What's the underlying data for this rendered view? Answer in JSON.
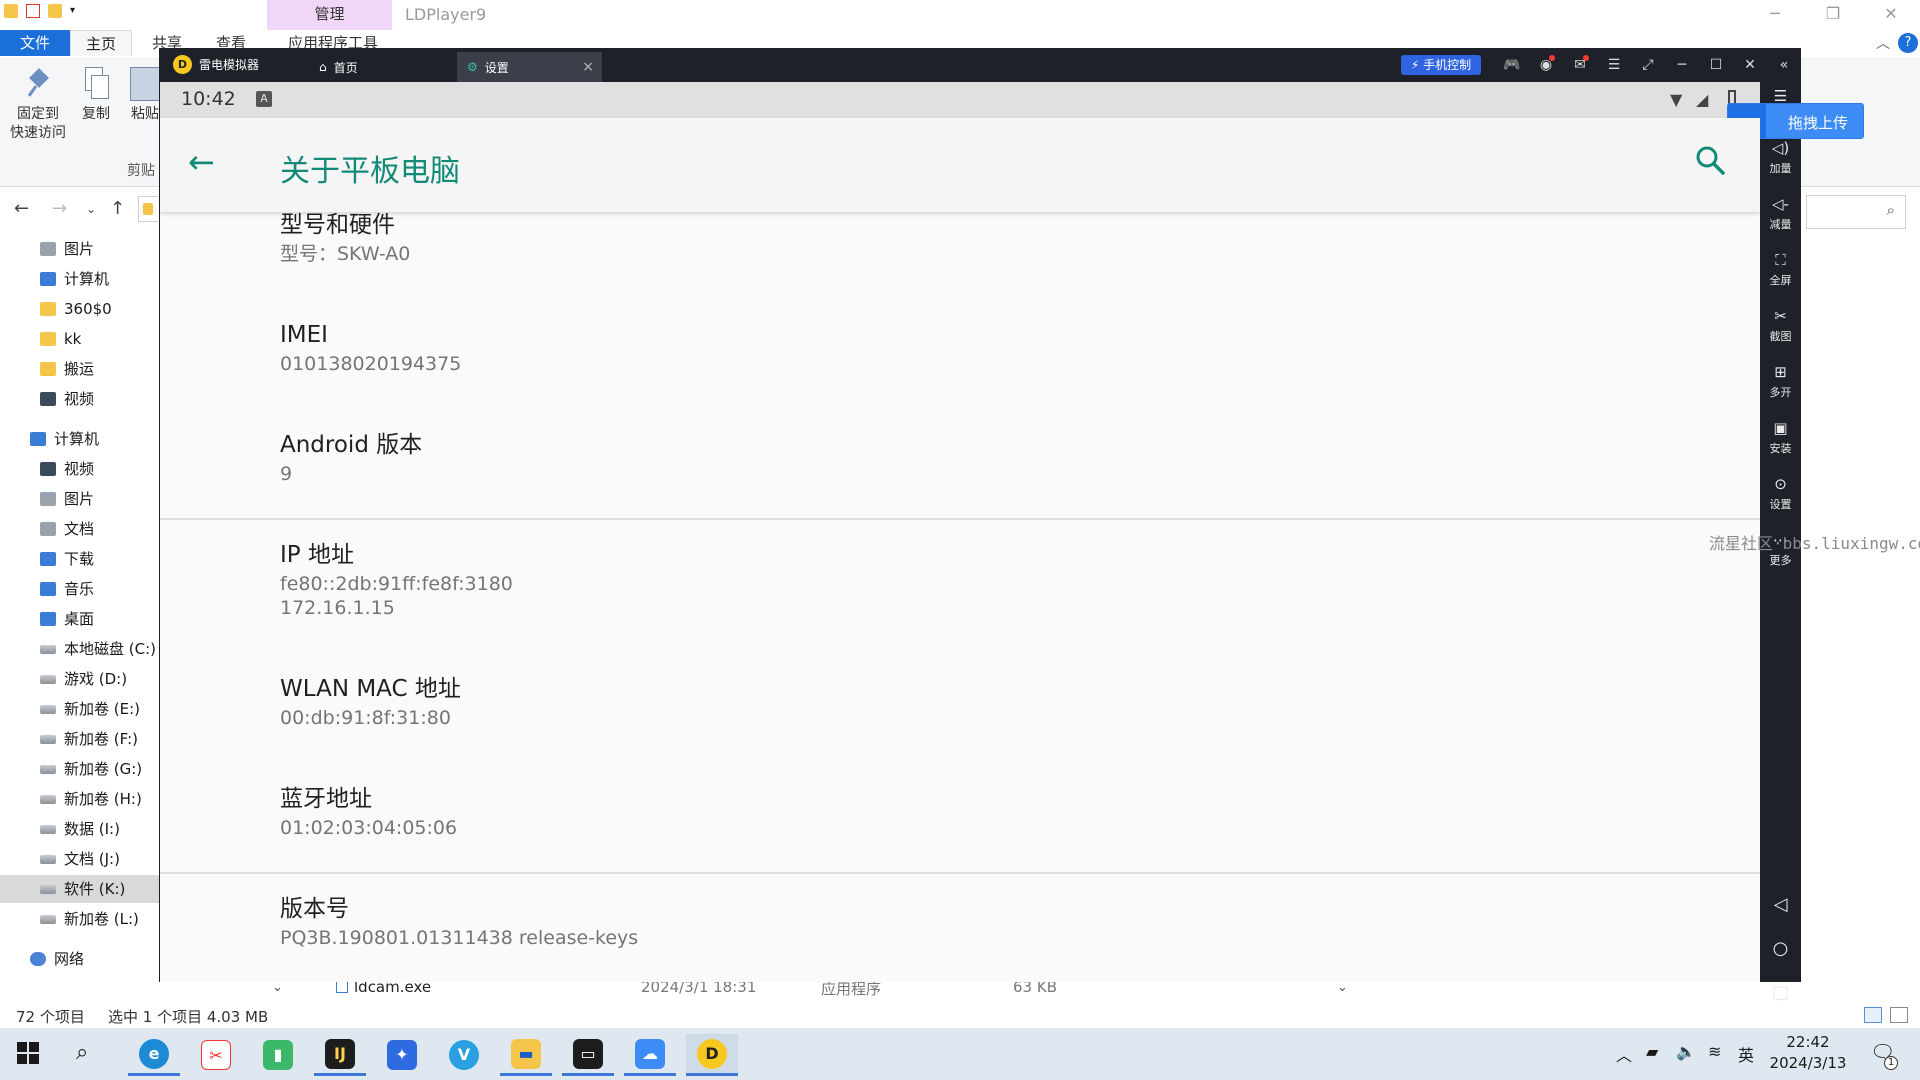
{
  "explorer": {
    "window_title": "LDPlayer9",
    "context_tab": "管理",
    "context_tab_sub": "应用程序工具",
    "ribbon_tabs": [
      "文件",
      "主页",
      "共享",
      "查看"
    ],
    "ribbon_buttons": [
      "固定到\n快速访问",
      "复制",
      "粘贴"
    ],
    "pin_label_1": "固定到",
    "pin_label_2": "快速访问",
    "copy_label": "复制",
    "paste_label": "粘贴",
    "clipboard_group": "剪贴",
    "nav_items": [
      {
        "label": "图片",
        "icon": "pictures-icon"
      },
      {
        "label": "计算机",
        "icon": "computer-icon"
      },
      {
        "label": "360$0",
        "icon": "folder-icon"
      },
      {
        "label": "kk",
        "icon": "folder-icon"
      },
      {
        "label": "搬运",
        "icon": "folder-icon"
      },
      {
        "label": "视频",
        "icon": "videos-icon"
      },
      {
        "label": "计算机",
        "icon": "computer-icon"
      },
      {
        "label": "视频",
        "icon": "videos-icon"
      },
      {
        "label": "图片",
        "icon": "pictures-icon"
      },
      {
        "label": "文档",
        "icon": "documents-icon"
      },
      {
        "label": "下载",
        "icon": "download-icon"
      },
      {
        "label": "音乐",
        "icon": "music-icon"
      },
      {
        "label": "桌面",
        "icon": "desktop-icon"
      },
      {
        "label": "本地磁盘 (C:)",
        "icon": "drive-icon"
      },
      {
        "label": "游戏 (D:)",
        "icon": "drive-icon"
      },
      {
        "label": "新加卷 (E:)",
        "icon": "drive-icon"
      },
      {
        "label": "新加卷 (F:)",
        "icon": "drive-icon"
      },
      {
        "label": "新加卷 (G:)",
        "icon": "drive-icon"
      },
      {
        "label": "新加卷 (H:)",
        "icon": "drive-icon"
      },
      {
        "label": "数据 (I:)",
        "icon": "drive-icon"
      },
      {
        "label": "文档 (J:)",
        "icon": "drive-icon"
      },
      {
        "label": "软件 (K:)",
        "icon": "drive-icon"
      },
      {
        "label": "新加卷 (L:)",
        "icon": "drive-icon"
      },
      {
        "label": "网络",
        "icon": "network-icon"
      }
    ],
    "file_peek": {
      "name": "ldcam.exe",
      "date": "2024/3/1 18:31",
      "type": "应用程序",
      "size": "63 KB"
    },
    "status_count": "72 个项目",
    "status_selected": "选中 1 个项目 4.03 MB"
  },
  "emulator": {
    "app_name": "雷电模拟器",
    "tabs": [
      {
        "label": "首页",
        "icon": "home-icon"
      },
      {
        "label": "设置",
        "icon": "gear-icon"
      }
    ],
    "phone_control": "手机控制",
    "toolbar": [
      {
        "label": "加量",
        "icon": "volume-up-icon"
      },
      {
        "label": "减量",
        "icon": "volume-down-icon"
      },
      {
        "label": "全屏",
        "icon": "fullscreen-icon"
      },
      {
        "label": "截图",
        "icon": "scissors-icon"
      },
      {
        "label": "多开",
        "icon": "multi-open-icon"
      },
      {
        "label": "安装",
        "icon": "apk-icon"
      },
      {
        "label": "设置",
        "icon": "settings-icon"
      },
      {
        "label": "更多",
        "icon": "more-icon"
      }
    ],
    "upload_button": "拖拽上传",
    "watermark": "流星社区·bbs.liuxingw.com"
  },
  "android": {
    "time": "10:42",
    "status_badge": "A",
    "title": "关于平板电脑",
    "accent": "#138a78",
    "prefs": [
      {
        "title": "型号和硬件",
        "summary": "型号：SKW-A0"
      },
      {
        "title": "IMEI",
        "summary": "010138020194375"
      },
      {
        "title": "Android 版本",
        "summary": "9"
      },
      {
        "title": "IP 地址",
        "summary": "fe80::2db:91ff:fe8f:3180",
        "summary2": "172.16.1.15"
      },
      {
        "title": "WLAN MAC 地址",
        "summary": "00:db:91:8f:31:80"
      },
      {
        "title": "蓝牙地址",
        "summary": "01:02:03:04:05:06"
      },
      {
        "title": "版本号",
        "summary": "PQ3B.190801.01311438 release-keys"
      }
    ]
  },
  "taskbar": {
    "ime": "英",
    "time": "22:42",
    "date": "2024/3/13",
    "notification_count": "1"
  }
}
